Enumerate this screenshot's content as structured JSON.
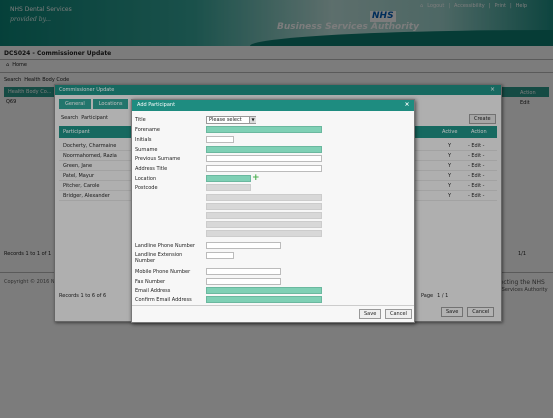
{
  "header": {
    "brand_name": "NHS Dental Services",
    "brand_tag": "provided by...",
    "nhs_logo": "NHS",
    "bsa_name": "Business Services Authority",
    "links": [
      "Logout",
      "Accessibility",
      "Print",
      "Help"
    ],
    "separator": "|"
  },
  "page": {
    "title": "DCS024 - Commissioner Update",
    "home": "Home"
  },
  "background": {
    "search_label": "Search",
    "search_value": "Health Body Code",
    "bar_label": "Health Body Co...",
    "row_code": "Q69",
    "action_header": "Action",
    "edit_link": "Edit",
    "records": "Records 1 to 1 of 1",
    "count": "1/1",
    "copyright": "Copyright © 2016 N...",
    "bsa_line1": "...ecting the NHS",
    "bsa_line2": "...l Services Authority"
  },
  "commissioner_window": {
    "title": "Commissioner Update",
    "close": "×",
    "tabs": [
      "General",
      "Locations"
    ],
    "search_label": "Search",
    "search_value": "Participant",
    "create_label": "Create",
    "columns": [
      "Participant",
      "Active",
      "Action"
    ],
    "rows": [
      {
        "name": "Docherty, Charmaine",
        "active": "Y",
        "action": "- Edit -"
      },
      {
        "name": "Noormahomed, Razia",
        "active": "Y",
        "action": "- Edit -"
      },
      {
        "name": "Green, Jane",
        "active": "Y",
        "action": "- Edit -"
      },
      {
        "name": "Patel, Mayur",
        "active": "Y",
        "action": "- Edit -"
      },
      {
        "name": "Pitcher, Carole",
        "active": "Y",
        "action": "- Edit -"
      },
      {
        "name": "Bridger, Alexander",
        "active": "Y",
        "action": "- Edit -"
      }
    ],
    "records": "Records 1 to 6 of 6",
    "page_label": "Page",
    "page_value": "1 / 1",
    "save_label": "Save",
    "cancel_label": "Cancel"
  },
  "dialog": {
    "title": "Add Participant",
    "close": "×",
    "title_label": "Title",
    "title_value": "Please select",
    "forename_label": "Forename",
    "initials_label": "Initials",
    "surname_label": "Surname",
    "previous_surname_label": "Previous Surname",
    "address_title_label": "Address Title",
    "location_label": "Location",
    "postcode_label": "Postcode",
    "landline_label": "Landline Phone Number",
    "landline_ext_label": "Landline Extension Number",
    "mobile_label": "Mobile Phone Number",
    "fax_label": "Fax Number",
    "email_label": "Email Address",
    "confirm_email_label": "Confirm Email Address",
    "add_location_icon": "plus-icon",
    "save_label": "Save",
    "cancel_label": "Cancel"
  },
  "colors": {
    "teal": "#1e8c80",
    "required_field": "#7fd0b5",
    "disabled_field": "#d8d8d8"
  }
}
